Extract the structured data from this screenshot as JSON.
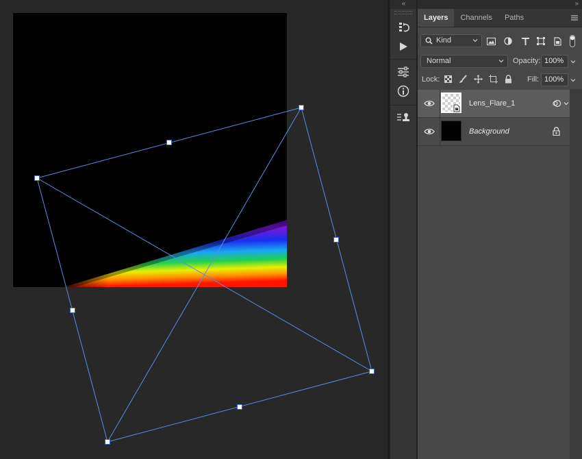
{
  "panel": {
    "tabs": [
      {
        "label": "Layers",
        "active": true
      },
      {
        "label": "Channels",
        "active": false
      },
      {
        "label": "Paths",
        "active": false
      }
    ],
    "collapse_glyph": "«",
    "expand_glyph": "»"
  },
  "filter": {
    "kind_label": "Kind",
    "icons": [
      "image-filter-icon",
      "adjustment-filter-icon",
      "type-filter-icon",
      "shape-filter-icon",
      "smart-object-filter-icon",
      "filter-toggle-icon"
    ]
  },
  "blend": {
    "mode": "Normal",
    "opacity_label": "Opacity:",
    "opacity_value": "100%"
  },
  "lock": {
    "label": "Lock:",
    "icons": [
      "lock-transparent-icon",
      "lock-image-icon",
      "lock-position-icon",
      "lock-artboard-icon",
      "lock-all-icon"
    ],
    "fill_label": "Fill:",
    "fill_value": "100%"
  },
  "layers": [
    {
      "name": "Lens_Flare_1",
      "visible": true,
      "selected": true,
      "type": "smart-object",
      "thumbnail": "transparent"
    },
    {
      "name": "Background",
      "visible": true,
      "selected": false,
      "locked": true,
      "thumbnail": "black"
    }
  ],
  "dock_tools": [
    "history-icon",
    "actions-play-icon",
    "properties-icon",
    "info-icon",
    "clone-source-icon"
  ],
  "colors": {
    "canvas_bg": "#282828",
    "panel_bg": "#474747",
    "transform_guide": "#5a8fe8",
    "document_bg": "#000000"
  }
}
